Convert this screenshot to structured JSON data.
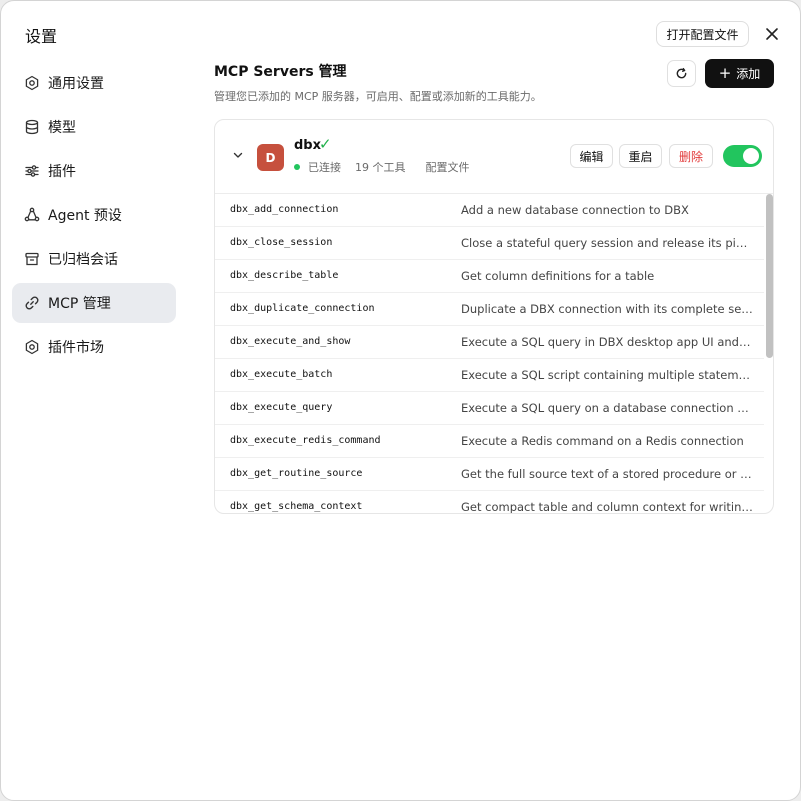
{
  "window": {
    "title": "设置",
    "open_config_label": "打开配置文件"
  },
  "sidebar": {
    "items": [
      {
        "label": "通用设置",
        "icon": "gear-icon"
      },
      {
        "label": "模型",
        "icon": "database-icon"
      },
      {
        "label": "插件",
        "icon": "sliders-icon"
      },
      {
        "label": "Agent 预设",
        "icon": "agent-icon"
      },
      {
        "label": "已归档会话",
        "icon": "archive-icon"
      },
      {
        "label": "MCP 管理",
        "icon": "link-icon",
        "active": true
      },
      {
        "label": "插件市场",
        "icon": "gear-icon"
      }
    ]
  },
  "main": {
    "title": "MCP Servers 管理",
    "description": "管理您已添加的 MCP 服务器，可启用、配置或添加新的工具能力。",
    "add_label": "添加"
  },
  "server": {
    "avatar_letter": "D",
    "avatar_color": "#c6503d",
    "name": "dbx",
    "check": "✓",
    "status": "已连接",
    "tools_count": "19 个工具",
    "config_label": "配置文件",
    "edit_label": "编辑",
    "restart_label": "重启",
    "delete_label": "删除",
    "enabled": true
  },
  "tools": [
    {
      "name": "dbx_add_connection",
      "description": "Add a new database connection to DBX"
    },
    {
      "name": "dbx_close_session",
      "description": "Close a stateful query session and release its pinned ..."
    },
    {
      "name": "dbx_describe_table",
      "description": "Get column definitions for a table"
    },
    {
      "name": "dbx_duplicate_connection",
      "description": "Duplicate a DBX connection with its complete setting..."
    },
    {
      "name": "dbx_execute_and_show",
      "description": "Execute a SQL query in DBX desktop app UI and sho..."
    },
    {
      "name": "dbx_execute_batch",
      "description": "Execute a SQL script containing multiple statements i..."
    },
    {
      "name": "dbx_execute_query",
      "description": "Execute a SQL query on a database connection (max ..."
    },
    {
      "name": "dbx_execute_redis_command",
      "description": "Execute a Redis command on a Redis connection"
    },
    {
      "name": "dbx_get_routine_source",
      "description": "Get the full source text of a stored procedure or func..."
    },
    {
      "name": "dbx_get_schema_context",
      "description": "Get compact table and column context for writing SQL"
    }
  ],
  "colors": {
    "accent_green": "#22c55e",
    "danger": "#e23b3b",
    "primary_dark": "#111111"
  }
}
